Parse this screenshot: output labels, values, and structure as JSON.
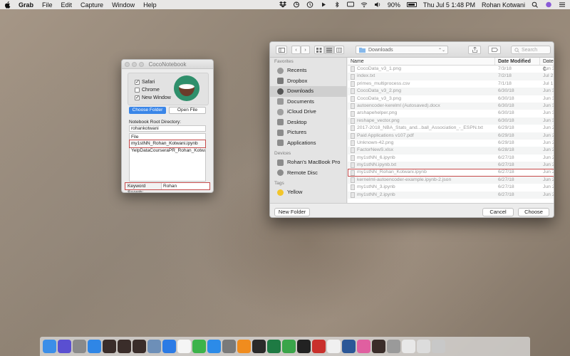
{
  "menubar": {
    "app": "Grab",
    "items": [
      "File",
      "Edit",
      "Capture",
      "Window",
      "Help"
    ],
    "battery": "90%",
    "datetime": "Thu Jul 5  1:48 PM",
    "user": "Rohan Kotwani"
  },
  "coco": {
    "title": "CocoNotebook",
    "checkboxes": [
      {
        "label": "Safari",
        "checked": true
      },
      {
        "label": "Chrome",
        "checked": false
      },
      {
        "label": "New Window",
        "checked": true
      }
    ],
    "choose_folder": "Choose Folder",
    "open_file": "Open File",
    "root_label": "Notebook Root Directory:",
    "root_value": "rohankotwani",
    "file_header": "File",
    "files": [
      "my1stNN_Rohan_Kotwani.ipynb",
      "YelpDataCourseraPR_Rohan_Kotwani.ipynb"
    ],
    "keyword_label": "Keyword Search:",
    "keyword_value": "Rohan"
  },
  "dialog": {
    "location": "Downloads",
    "search_placeholder": "Search",
    "sidebar": {
      "favorites_header": "Favorites",
      "favorites": [
        "Recents",
        "Dropbox",
        "Downloads",
        "Documents",
        "iCloud Drive",
        "Desktop",
        "Pictures",
        "Applications"
      ],
      "devices_header": "Devices",
      "devices": [
        "Rohan's MacBook Pro",
        "Remote Disc"
      ],
      "tags_header": "Tags",
      "tags": [
        "Yellow"
      ]
    },
    "columns": {
      "name": "Name",
      "date": "Date Modified",
      "created": "Date C"
    },
    "files": [
      {
        "name": "CocoData_v3_1.png",
        "date": "7/3/18",
        "created": "Jun 30"
      },
      {
        "name": "index.txt",
        "date": "7/2/18",
        "created": "Jul 2, "
      },
      {
        "name": "primes_multiprocess.csv",
        "date": "7/1/18",
        "created": "Jul 1, "
      },
      {
        "name": "CocoData_v3_2.png",
        "date": "6/30/18",
        "created": "Jun 30"
      },
      {
        "name": "CocoData_v3_3.png",
        "date": "6/30/18",
        "created": "Jun 30"
      },
      {
        "name": "autoencoder-kerelml (Autosaved).docx",
        "date": "6/30/18",
        "created": "Jun 30"
      },
      {
        "name": "arshapehelper.png",
        "date": "6/30/18",
        "created": "Jun 30"
      },
      {
        "name": "reshape_vector.png",
        "date": "6/30/18",
        "created": "Jun 30"
      },
      {
        "name": "2017-2018_NBA_Stats_and...ball_Association_-_ESPN.txt",
        "date": "6/29/18",
        "created": "Jun 29"
      },
      {
        "name": "Paid Applications v107.pdf",
        "date": "6/29/18",
        "created": "Jun 29"
      },
      {
        "name": "Unknown-42.png",
        "date": "6/29/18",
        "created": "Jun 29"
      },
      {
        "name": "FactorNewS.xlsx",
        "date": "6/28/18",
        "created": "Jun 28"
      },
      {
        "name": "my1stNN_6.ipynb",
        "date": "6/27/18",
        "created": "Jun 27"
      },
      {
        "name": "my1stNN.ipynb.txt",
        "date": "6/27/18",
        "created": "Jun 27"
      },
      {
        "name": "my1stNN_Rohan_Kotwani.ipynb",
        "date": "6/27/18",
        "created": "Jun 27"
      },
      {
        "name": "kernelml-autoencoder-example.ipynb-2.json",
        "date": "6/27/18",
        "created": "Jun 27"
      },
      {
        "name": "my1stNN_3.ipynb",
        "date": "6/27/18",
        "created": "Jun 27"
      },
      {
        "name": "my1stNN_2.ipynb",
        "date": "6/27/18",
        "created": "Jun 27"
      }
    ],
    "highlighted_index": 14,
    "new_folder": "New Folder",
    "cancel": "Cancel",
    "choose": "Choose"
  },
  "dock": {
    "icons": [
      "finder",
      "siri",
      "launchpad",
      "safari",
      "coconotebook",
      "coconotebook",
      "coconotebook",
      "preview",
      "messages",
      "calendar",
      "facetime",
      "appstore",
      "system-preferences",
      "vlc",
      "terminal",
      "excel",
      "anaconda",
      "activity-monitor",
      "acrobat",
      "textedit",
      "word",
      "itunes",
      "coconotebook",
      "grab",
      "documents",
      "mail",
      "trash"
    ],
    "colors": [
      "#3b8ee8",
      "#5a4fd1",
      "#8a8a8a",
      "#2f86e6",
      "#3a2d2a",
      "#3a2d2a",
      "#3a2d2a",
      "#6d8fb8",
      "#2c7be5",
      "#f5f5f5",
      "#3cb34a",
      "#2c8be8",
      "#7a7a7a",
      "#f08c1e",
      "#2a2a2a",
      "#1e7a43",
      "#3aa54a",
      "#222222",
      "#c9302c",
      "#f0f0f0",
      "#2b5797",
      "#e05fa0",
      "#3a2d2a",
      "#9a9a9a",
      "#e8e8e8",
      "#dcdcdc",
      "#c8c8c8"
    ]
  }
}
